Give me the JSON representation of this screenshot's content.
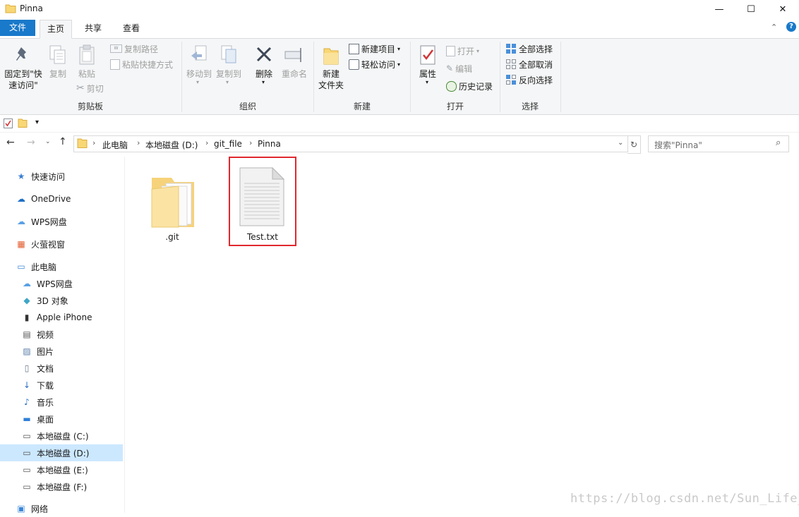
{
  "window": {
    "title": "Pinna",
    "minimize": "—",
    "maximize": "☐",
    "close": "✕"
  },
  "tabs": {
    "file": "文件",
    "home": "主页",
    "share": "共享",
    "view": "查看"
  },
  "ribbon": {
    "clipboard": {
      "label": "剪贴板",
      "pin_line1": "固定到\"快",
      "pin_line2": "速访问\"",
      "copy": "复制",
      "paste": "粘贴",
      "copy_path": "复制路径",
      "paste_shortcut": "粘贴快捷方式",
      "cut": "剪切"
    },
    "organize": {
      "label": "组织",
      "move_to": "移动到",
      "copy_to": "复制到",
      "delete": "删除",
      "rename": "重命名"
    },
    "new": {
      "label": "新建",
      "new_folder_line1": "新建",
      "new_folder_line2": "文件夹",
      "new_item": "新建项目",
      "easy_access": "轻松访问"
    },
    "open": {
      "label": "打开",
      "properties": "属性",
      "open": "打开",
      "edit": "编辑",
      "history": "历史记录"
    },
    "select": {
      "label": "选择",
      "select_all": "全部选择",
      "select_none": "全部取消",
      "invert": "反向选择"
    }
  },
  "address": {
    "crumbs": [
      "此电脑",
      "本地磁盘 (D:)",
      "git_file",
      "Pinna"
    ],
    "search_placeholder": "搜索\"Pinna\""
  },
  "nav": {
    "items": [
      {
        "label": "快速访问",
        "icon": "star-icon"
      },
      {
        "label": "OneDrive",
        "icon": "cloud-icon"
      },
      {
        "label": "WPS网盘",
        "icon": "cloud-outline-icon"
      },
      {
        "label": "火萤视窗",
        "icon": "windows-icon"
      },
      {
        "label": "此电脑",
        "icon": "computer-icon"
      },
      {
        "label": "WPS网盘",
        "icon": "cloud-outline-icon"
      },
      {
        "label": "3D 对象",
        "icon": "cube-icon"
      },
      {
        "label": "Apple iPhone",
        "icon": "phone-icon"
      },
      {
        "label": "视频",
        "icon": "video-icon"
      },
      {
        "label": "图片",
        "icon": "picture-icon"
      },
      {
        "label": "文档",
        "icon": "document-icon"
      },
      {
        "label": "下载",
        "icon": "download-icon"
      },
      {
        "label": "音乐",
        "icon": "music-icon"
      },
      {
        "label": "桌面",
        "icon": "desktop-icon"
      },
      {
        "label": "本地磁盘 (C:)",
        "icon": "drive-icon"
      },
      {
        "label": "本地磁盘 (D:)",
        "icon": "drive-icon"
      },
      {
        "label": "本地磁盘 (E:)",
        "icon": "drive-icon"
      },
      {
        "label": "本地磁盘 (F:)",
        "icon": "drive-icon"
      },
      {
        "label": "网络",
        "icon": "network-icon"
      }
    ]
  },
  "files": [
    {
      "name": ".git",
      "type": "folder"
    },
    {
      "name": "Test.txt",
      "type": "text-file"
    }
  ],
  "watermark": "https://blog.csdn.net/Sun_Life_",
  "colors": {
    "accent": "#1979ca",
    "selected": "#cce8ff",
    "highlight_border": "#e0282e"
  }
}
